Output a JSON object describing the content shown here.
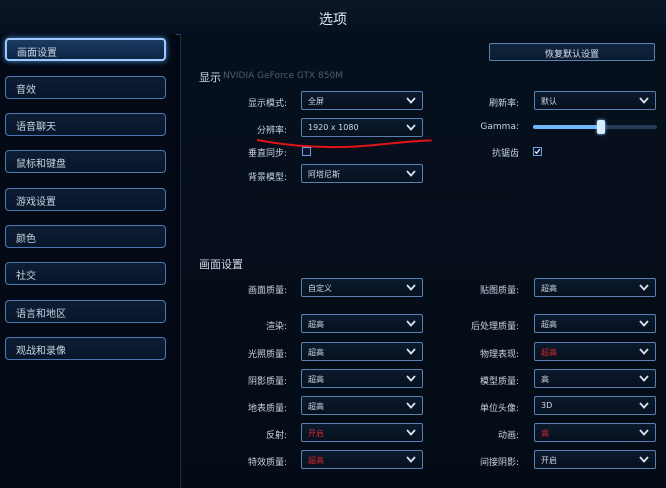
{
  "window": {
    "title": "选项"
  },
  "sidebar": {
    "items": [
      {
        "label": "画面设置",
        "active": true
      },
      {
        "label": "音效"
      },
      {
        "label": "语音聊天"
      },
      {
        "label": "鼠标和键盘"
      },
      {
        "label": "游戏设置"
      },
      {
        "label": "颜色"
      },
      {
        "label": "社交"
      },
      {
        "label": "语言和地区"
      },
      {
        "label": "观战和录像"
      }
    ]
  },
  "reset_button": "恢复默认设置",
  "display": {
    "title": "显示",
    "gpu": "NVIDIA GeForce GTX 850M",
    "mode_label": "显示模式:",
    "mode_value": "全屏",
    "resolution_label": "分辨率:",
    "resolution_value": "1920 x 1080",
    "vsync_label": "垂直同步:",
    "vsync_checked": false,
    "bgmodel_label": "背景模型:",
    "bgmodel_value": "阿塔尼斯",
    "refresh_label": "刷新率:",
    "refresh_value": "默认",
    "gamma_label": "Gamma:",
    "gamma_level": 0.55,
    "aa_label": "抗锯齿",
    "aa_checked": true
  },
  "graphics": {
    "title": "画面设置",
    "left": [
      {
        "label": "画面质量:",
        "value": "自定义"
      },
      {
        "label": "渲染:",
        "value": "超高"
      },
      {
        "label": "光照质量:",
        "value": "超高"
      },
      {
        "label": "阴影质量:",
        "value": "超高"
      },
      {
        "label": "地表质量:",
        "value": "超高"
      },
      {
        "label": "反射:",
        "value": "开启",
        "red": true
      },
      {
        "label": "特效质量:",
        "value": "超高",
        "red": true
      }
    ],
    "right": [
      {
        "label": "贴图质量:",
        "value": "超高"
      },
      {
        "label": "后处理质量:",
        "value": "超高"
      },
      {
        "label": "物理表现:",
        "value": "超高",
        "red": true
      },
      {
        "label": "模型质量:",
        "value": "高"
      },
      {
        "label": "单位头像:",
        "value": "3D"
      },
      {
        "label": "动画:",
        "value": "高",
        "red": true
      },
      {
        "label": "间接阴影:",
        "value": "开启"
      }
    ]
  },
  "colors": {
    "accent": "#6fb6ff",
    "warning": "#d8262a",
    "annotation": "#e0141a"
  }
}
